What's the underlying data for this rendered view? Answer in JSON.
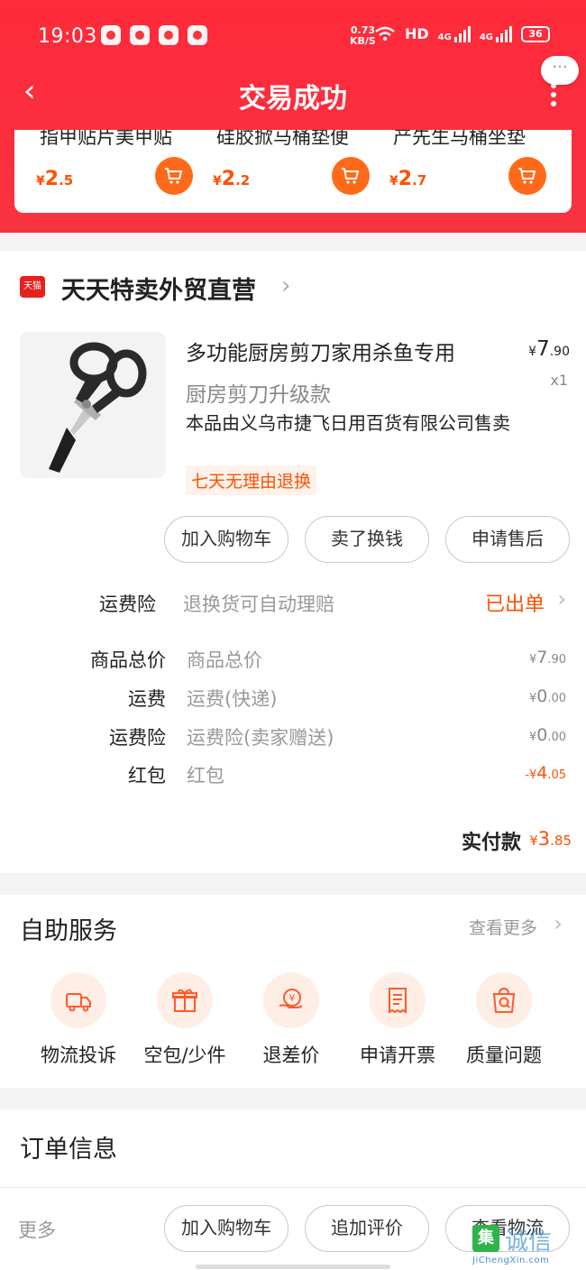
{
  "status_bar": {
    "time": "19:03",
    "net_speed_value": "0.73",
    "net_speed_unit": "KB/S",
    "hd": "HD",
    "net1": "4G",
    "net2": "4G",
    "battery": "36"
  },
  "navbar": {
    "back_icon": "‹",
    "title": "交易成功",
    "float_dots": "···"
  },
  "recommendations": [
    {
      "name": "指甲贴片美甲贴",
      "currency": "¥",
      "price_int": "2",
      "price_dec": ".5"
    },
    {
      "name": "硅胶掀马桶垫便",
      "currency": "¥",
      "price_int": "2",
      "price_dec": ".2"
    },
    {
      "name": "产先生马桶坐垫",
      "currency": "¥",
      "price_int": "2",
      "price_dec": ".7"
    }
  ],
  "store": {
    "logo_text": "天猫",
    "name": "天天特卖外贸直营",
    "chevron": "›"
  },
  "product": {
    "title": "多功能厨房剪刀家用杀鱼专用",
    "spec": "厨房剪刀升级款",
    "seller": "本品由义乌市捷飞日用百货有限公司售卖",
    "return_tag": "七天无理由退换",
    "price_currency": "¥",
    "price_int": "7",
    "price_dec": ".90",
    "qty": "x1"
  },
  "actions": {
    "add_cart": "加入购物车",
    "sell": "卖了换钱",
    "after_sale": "申请售后"
  },
  "insurance": {
    "label": "运费险",
    "desc": "退换货可自动理赔",
    "status": "已出单"
  },
  "price_rows": [
    {
      "label": "商品总价",
      "desc": "商品总价",
      "prefix": "¥",
      "int": "7",
      "dec": ".90"
    },
    {
      "label": "运费",
      "desc": "运费(快递)",
      "prefix": "¥",
      "int": "0",
      "dec": ".00"
    },
    {
      "label": "运费险",
      "desc": "运费险(卖家赠送)",
      "prefix": "¥",
      "int": "0",
      "dec": ".00"
    },
    {
      "label": "红包",
      "desc": "红包",
      "prefix": "-¥",
      "int": "4",
      "dec": ".05"
    }
  ],
  "total": {
    "label": "实付款",
    "currency": "¥",
    "int": "3",
    "dec": ".85"
  },
  "self_service": {
    "title": "自助服务",
    "more": "查看更多",
    "items": [
      {
        "label": "物流投诉",
        "icon": "truck-icon"
      },
      {
        "label": "空包/少件",
        "icon": "gift-box-icon"
      },
      {
        "label": "退差价",
        "icon": "refund-coin-icon"
      },
      {
        "label": "申请开票",
        "icon": "receipt-icon"
      },
      {
        "label": "质量问题",
        "icon": "quality-bag-icon"
      }
    ]
  },
  "order_info": {
    "title": "订单信息"
  },
  "bottom_bar": {
    "more": "更多",
    "add_cart": "加入购物车",
    "add_review": "追加评价",
    "view_logistics": "查看物流"
  },
  "watermark": {
    "badge": "集",
    "text": "诚信",
    "url": "JiChengXin.com"
  },
  "colors": {
    "brand_red": "#fb2e3e",
    "accent_orange": "#ff5000",
    "cart_orange": "#ff6a1a",
    "tmall_red": "#e8201b"
  }
}
